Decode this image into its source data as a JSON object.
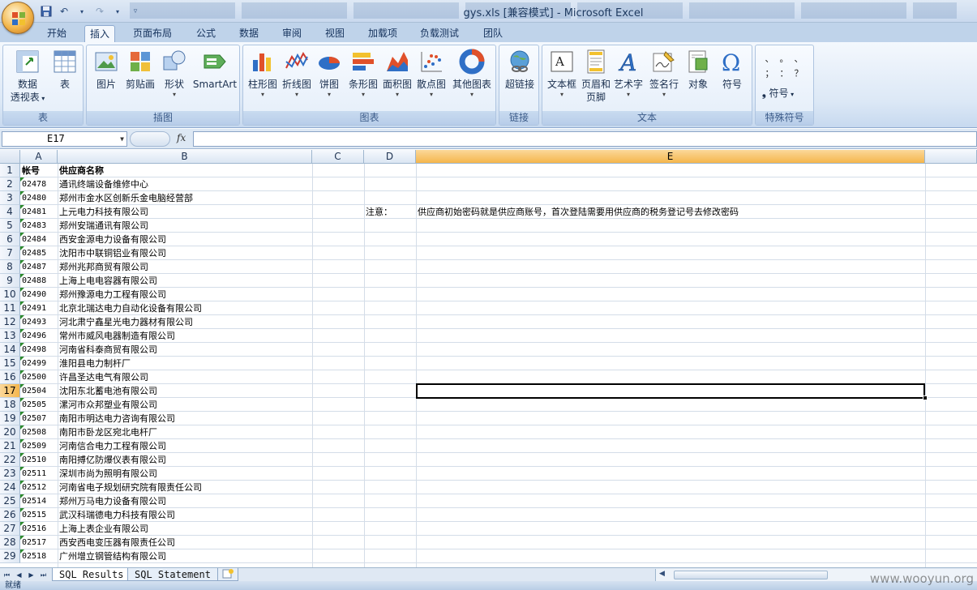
{
  "window": {
    "title": "gys.xls  [兼容模式] - Microsoft Excel"
  },
  "ribbon_tabs": [
    "开始",
    "插入",
    "页面布局",
    "公式",
    "数据",
    "审阅",
    "视图",
    "加载项",
    "负载测试",
    "团队"
  ],
  "ribbon": {
    "groups": {
      "table": {
        "name": "表",
        "pivot_label_1": "数据",
        "pivot_label_2": "透视表",
        "table_label": "表"
      },
      "illustrations": {
        "name": "插图",
        "picture": "图片",
        "clipart": "剪贴画",
        "shapes": "形状",
        "smartart": "SmartArt"
      },
      "charts": {
        "name": "图表",
        "column": "柱形图",
        "line": "折线图",
        "pie": "饼图",
        "bar": "条形图",
        "area": "面积图",
        "scatter": "散点图",
        "other": "其他图表"
      },
      "links": {
        "name": "链接",
        "hyperlink": "超链接"
      },
      "text": {
        "name": "文本",
        "textbox": "文本框",
        "header_footer_1": "页眉和",
        "header_footer_2": "页脚",
        "wordart": "艺术字",
        "signature": "签名行",
        "object": "对象",
        "symbol": "符号"
      },
      "special": {
        "name": "特殊符号",
        "symbols": [
          "、",
          "。",
          "、",
          "；",
          "：",
          "？"
        ],
        "symbol_button": "符号"
      }
    }
  },
  "formula_bar": {
    "name_box": "E17",
    "fx": "fx",
    "formula": ""
  },
  "columns": [
    "A",
    "B",
    "C",
    "D",
    "E"
  ],
  "selected_column": "E",
  "selected_row": "17",
  "rows": [
    {
      "n": "1",
      "a": "帐号",
      "b": "供应商名称",
      "bold": true
    },
    {
      "n": "2",
      "a": "02478",
      "b": "通讯终端设备维修中心"
    },
    {
      "n": "3",
      "a": "02480",
      "b": "郑州市金水区创新乐金电脑经营部"
    },
    {
      "n": "4",
      "a": "02481",
      "b": "上元电力科技有限公司",
      "d": "注意：",
      "e": "供应商初始密码就是供应商账号，首次登陆需要用供应商的税务登记号去修改密码"
    },
    {
      "n": "5",
      "a": "02483",
      "b": "郑州安瑞通讯有限公司"
    },
    {
      "n": "6",
      "a": "02484",
      "b": "西安金源电力设备有限公司"
    },
    {
      "n": "7",
      "a": "02485",
      "b": "沈阳市中联铜铝业有限公司"
    },
    {
      "n": "8",
      "a": "02487",
      "b": "郑州兆邦商贸有限公司"
    },
    {
      "n": "9",
      "a": "02488",
      "b": "上海上电电容器有限公司"
    },
    {
      "n": "10",
      "a": "02490",
      "b": "郑州豫源电力工程有限公司"
    },
    {
      "n": "11",
      "a": "02491",
      "b": "北京北瑞达电力自动化设备有限公司"
    },
    {
      "n": "12",
      "a": "02493",
      "b": "河北肃宁鑫星光电力器材有限公司"
    },
    {
      "n": "13",
      "a": "02496",
      "b": "常州市威风电器制造有限公司"
    },
    {
      "n": "14",
      "a": "02498",
      "b": "河南省科泰商贸有限公司"
    },
    {
      "n": "15",
      "a": "02499",
      "b": "淮阳县电力制杆厂"
    },
    {
      "n": "16",
      "a": "02500",
      "b": "许昌圣达电气有限公司"
    },
    {
      "n": "17",
      "a": "02504",
      "b": "沈阳东北蓄电池有限公司"
    },
    {
      "n": "18",
      "a": "02505",
      "b": "漯河市众邦塑业有限公司"
    },
    {
      "n": "19",
      "a": "02507",
      "b": "南阳市明达电力咨询有限公司"
    },
    {
      "n": "20",
      "a": "02508",
      "b": "南阳市卧龙区宛北电杆厂"
    },
    {
      "n": "21",
      "a": "02509",
      "b": "河南信合电力工程有限公司"
    },
    {
      "n": "22",
      "a": "02510",
      "b": "南阳搏亿防爆仪表有限公司"
    },
    {
      "n": "23",
      "a": "02511",
      "b": "深圳市尚为照明有限公司"
    },
    {
      "n": "24",
      "a": "02512",
      "b": "河南省电子规划研究院有限责任公司"
    },
    {
      "n": "25",
      "a": "02514",
      "b": "郑州万马电力设备有限公司"
    },
    {
      "n": "26",
      "a": "02515",
      "b": "武汉科瑞德电力科技有限公司"
    },
    {
      "n": "27",
      "a": "02516",
      "b": "上海上表企业有限公司"
    },
    {
      "n": "28",
      "a": "02517",
      "b": "西安西电变压器有限责任公司"
    },
    {
      "n": "29",
      "a": "02518",
      "b": "广州增立钢管结构有限公司"
    }
  ],
  "sheet_tabs": [
    "SQL Results",
    "SQL Statement"
  ],
  "status": "就绪",
  "watermark": "www.wooyun.org"
}
